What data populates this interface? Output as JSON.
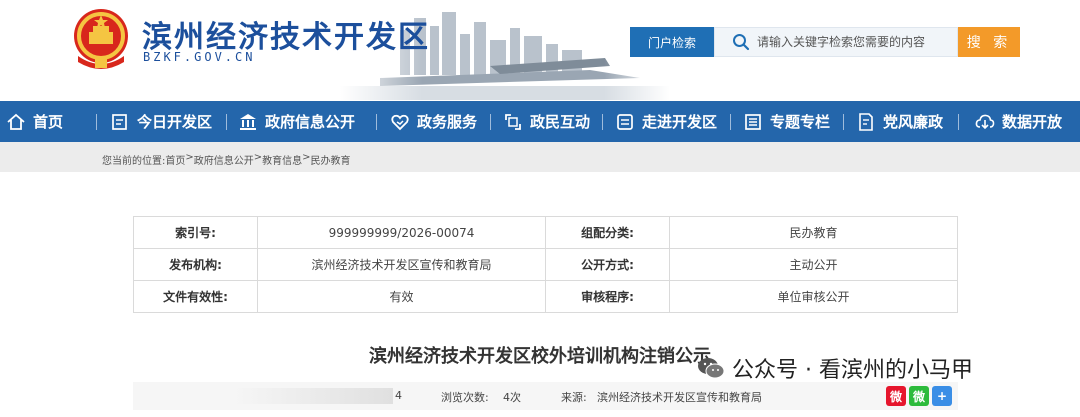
{
  "header": {
    "site_name": "滨州经济技术开发区",
    "site_domain": "BZKF.GOV.CN",
    "portal_tab": "门户检索",
    "search_placeholder": "请输入关键字检索您需要的内容",
    "search_button": "搜 索"
  },
  "nav": {
    "items": [
      {
        "label": "首页",
        "icon": "home-icon"
      },
      {
        "label": "今日开发区",
        "icon": "calendar-icon"
      },
      {
        "label": "政府信息公开",
        "icon": "government-icon"
      },
      {
        "label": "政务服务",
        "icon": "heart-service-icon"
      },
      {
        "label": "政民互动",
        "icon": "interaction-icon"
      },
      {
        "label": "走进开发区",
        "icon": "document-icon"
      },
      {
        "label": "专题专栏",
        "icon": "list-icon"
      },
      {
        "label": "党风廉政",
        "icon": "edit-document-icon"
      },
      {
        "label": "数据开放",
        "icon": "cloud-download-icon"
      }
    ]
  },
  "breadcrumb": {
    "prefix": "您当前的位置:",
    "items": [
      "首页",
      "政府信息公开",
      "教育信息",
      "民办教育"
    ],
    "separator": ">"
  },
  "info_table": {
    "rows": [
      [
        "索引号:",
        "999999999/2026-00074",
        "组配分类:",
        "民办教育"
      ],
      [
        "发布机构:",
        "滨州经济技术开发区宣传和教育局",
        "公开方式:",
        "主动公开"
      ],
      [
        "文件有效性:",
        "有效",
        "审核程序:",
        "单位审核公开"
      ]
    ]
  },
  "article": {
    "title": "滨州经济技术开发区校外培训机构注销公示"
  },
  "meta": {
    "date_tail": "4",
    "views_label": "浏览次数:",
    "views_value": "4次",
    "source_label": "来源:",
    "source_value": "滨州经济技术开发区宣传和教育局"
  },
  "share": {
    "icons": [
      "weibo-icon",
      "wechat-icon",
      "plus-share-icon"
    ]
  },
  "watermark": {
    "text": "公众号 · 看滨州的小马甲"
  },
  "colors": {
    "brand_blue": "#1c4f9c",
    "nav_blue": "#2466ab",
    "tab_blue": "#1f6fb5",
    "search_orange": "#f39a29"
  }
}
